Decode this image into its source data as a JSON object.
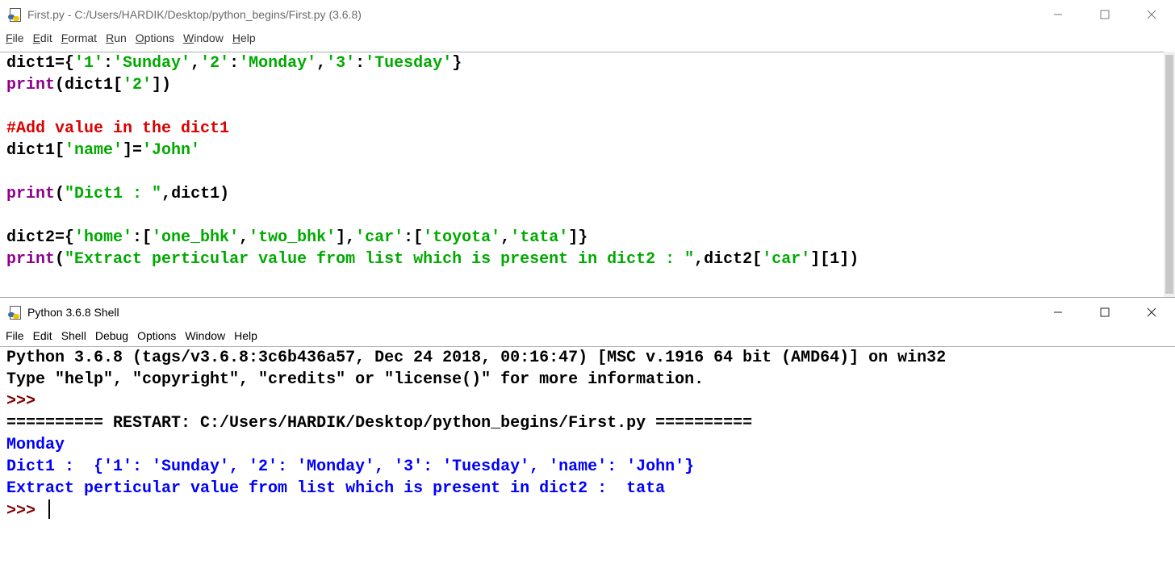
{
  "editor": {
    "title": "First.py - C:/Users/HARDIK/Desktop/python_begins/First.py (3.6.8)",
    "menu": [
      {
        "u": "F",
        "rest": "ile"
      },
      {
        "u": "E",
        "rest": "dit"
      },
      {
        "u": "F",
        "rest": "ormat"
      },
      {
        "u": "R",
        "rest": "un"
      },
      {
        "u": "O",
        "rest": "ptions"
      },
      {
        "u": "W",
        "rest": "indow"
      },
      {
        "u": "H",
        "rest": "elp"
      }
    ],
    "lines": [
      [
        [
          "def",
          "dict1={"
        ],
        [
          "str",
          "'1'"
        ],
        [
          "def",
          ":"
        ],
        [
          "str",
          "'Sunday'"
        ],
        [
          "def",
          ","
        ],
        [
          "str",
          "'2'"
        ],
        [
          "def",
          ":"
        ],
        [
          "str",
          "'Monday'"
        ],
        [
          "def",
          ","
        ],
        [
          "str",
          "'3'"
        ],
        [
          "def",
          ":"
        ],
        [
          "str",
          "'Tuesday'"
        ],
        [
          "def",
          "}"
        ]
      ],
      [
        [
          "kw",
          "print"
        ],
        [
          "def",
          "(dict1["
        ],
        [
          "str",
          "'2'"
        ],
        [
          "def",
          "])"
        ]
      ],
      [],
      [
        [
          "cm",
          "#Add value in the dict1"
        ]
      ],
      [
        [
          "def",
          "dict1["
        ],
        [
          "str",
          "'name'"
        ],
        [
          "def",
          "]="
        ],
        [
          "str",
          "'John'"
        ]
      ],
      [],
      [
        [
          "kw",
          "print"
        ],
        [
          "def",
          "("
        ],
        [
          "str",
          "\"Dict1 : \""
        ],
        [
          "def",
          ",dict1)"
        ]
      ],
      [],
      [
        [
          "def",
          "dict2={"
        ],
        [
          "str",
          "'home'"
        ],
        [
          "def",
          ":["
        ],
        [
          "str",
          "'one_bhk'"
        ],
        [
          "def",
          ","
        ],
        [
          "str",
          "'two_bhk'"
        ],
        [
          "def",
          "],"
        ],
        [
          "str",
          "'car'"
        ],
        [
          "def",
          ":["
        ],
        [
          "str",
          "'toyota'"
        ],
        [
          "def",
          ","
        ],
        [
          "str",
          "'tata'"
        ],
        [
          "def",
          "]}"
        ]
      ],
      [
        [
          "kw",
          "print"
        ],
        [
          "def",
          "("
        ],
        [
          "str",
          "\"Extract perticular value from list which is present in dict2 : \""
        ],
        [
          "def",
          ",dict2["
        ],
        [
          "str",
          "'car'"
        ],
        [
          "def",
          "][1])"
        ]
      ]
    ]
  },
  "shell": {
    "title": "Python 3.6.8 Shell",
    "menu": [
      "File",
      "Edit",
      "Shell",
      "Debug",
      "Options",
      "Window",
      "Help"
    ],
    "lines": [
      [
        [
          "def",
          "Python 3.6.8 (tags/v3.6.8:3c6b436a57, Dec 24 2018, 00:16:47) [MSC v.1916 64 bit (AMD64)] on win32"
        ]
      ],
      [
        [
          "def",
          "Type \"help\", \"copyright\", \"credits\" or \"license()\" for more information."
        ]
      ],
      [
        [
          "pr",
          ">>> "
        ]
      ],
      [
        [
          "def",
          "========== RESTART: C:/Users/HARDIK/Desktop/python_begins/First.py =========="
        ]
      ],
      [
        [
          "out",
          "Monday"
        ]
      ],
      [
        [
          "out",
          "Dict1 :  {'1': 'Sunday', '2': 'Monday', '3': 'Tuesday', 'name': 'John'}"
        ]
      ],
      [
        [
          "out",
          "Extract perticular value from list which is present in dict2 :  tata"
        ]
      ],
      [
        [
          "pr",
          ">>> "
        ]
      ]
    ]
  }
}
